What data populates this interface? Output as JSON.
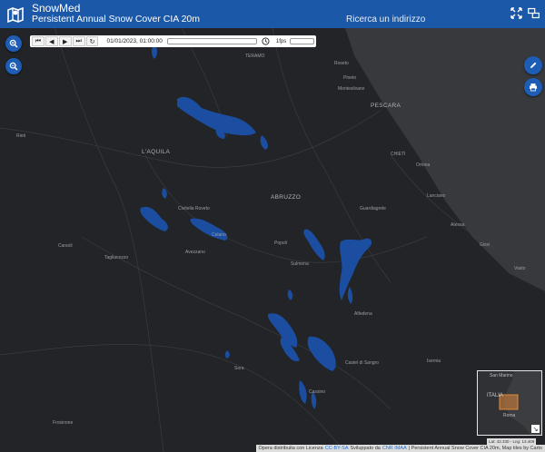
{
  "header": {
    "title": "SnowMed",
    "subtitle": "Persistent Annual Snow Cover CIA 20m",
    "search_label": "Ricerca un indirizzo",
    "icons": [
      "map-icon",
      "fullscreen-icon",
      "compare-icon"
    ]
  },
  "player": {
    "date": "01/01/2023, 01:00:00",
    "fps": "1fps",
    "buttons": [
      "first",
      "previous",
      "play",
      "last",
      "loop"
    ]
  },
  "map_labels": {
    "pescara": "PESCARA",
    "laquila": "L'AQUILA",
    "abruzzo": "ABRUZZO",
    "chieti": "CHIETI",
    "teramo": "TERAMO",
    "roseto": "Roseto",
    "montesilvano": "Montesilvano",
    "pineto": "Pineto",
    "ortona": "Ortona",
    "lanciano": "Lanciano",
    "vasto": "Vasto",
    "avezzano": "Avezzano",
    "sulmona": "Sulmona",
    "celano": "Celano",
    "tagliacozzo": "Tagliacozzo",
    "rieti": "Rieti",
    "carsoli": "Carsoli",
    "sora": "Sora",
    "isernia": "Isernia",
    "cassino": "Cassino",
    "castel_di_sangro": "Castel di Sangro",
    "popoli": "Popoli",
    "guardiagrele": "Guardiagrele",
    "atessa": "Atessa",
    "civitella": "Civitella Roveto",
    "alfedena": "Alfedena",
    "frosinone": "Frosinone",
    "gissi": "Gissi"
  },
  "minimap": {
    "labels": [
      "San Marino",
      "ITALIA",
      "Roma"
    ],
    "toggle": "↘"
  },
  "coords": "Lat: 42.330 - Lng: 13.469",
  "attribution": {
    "prefix": "Opera distribuita con Licenza",
    "license": "CC-BY-SA",
    "developed_by": "Sviluppato da",
    "org": "CNR IMAA",
    "suffix": "| Persistent Annual Snow Cover CIA 20m, Map tiles by Carto"
  },
  "colors": {
    "header": "#1c58a8",
    "snow": "#1b4ea0",
    "map_bg": "#222427",
    "sea": "#3a3c3f"
  }
}
